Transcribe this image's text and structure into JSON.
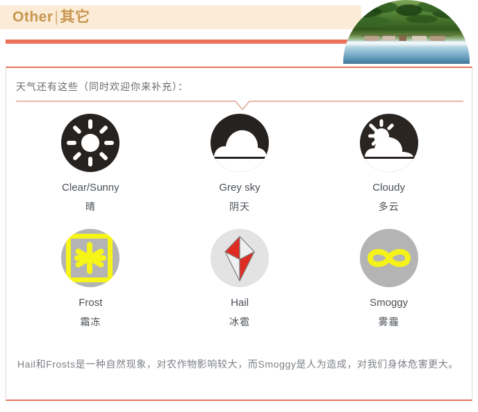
{
  "header": {
    "title_en": "Other",
    "separator": "|",
    "title_zh": "其它",
    "photo_alt": "mountain-village-river-photo"
  },
  "card": {
    "intro": "天气还有这些（同时欢迎你来补充）：",
    "note": "Hail和Frosts是一种自然现象，对农作物影响较大，而Smoggy是人为造成，对我们身体危害更大。"
  },
  "weather_items": [
    {
      "icon": "clear-sunny-icon",
      "label_en": "Clear/Sunny",
      "label_zh": "晴",
      "circle_color": "#262220",
      "glyph_color": "#ffffff"
    },
    {
      "icon": "grey-sky-icon",
      "label_en": "Grey sky",
      "label_zh": "阴天",
      "circle_color": "#262220",
      "glyph_color": "#ffffff"
    },
    {
      "icon": "cloudy-icon",
      "label_en": "Cloudy",
      "label_zh": "多云",
      "circle_color": "#2b2522",
      "glyph_color": "#ffffff"
    },
    {
      "icon": "frost-icon",
      "label_en": "Frost",
      "label_zh": "霜冻",
      "circle_color": "#b4b4b4",
      "glyph_color": "#f7f518"
    },
    {
      "icon": "hail-icon",
      "label_en": "Hail",
      "label_zh": "冰雹",
      "circle_color": "#e3e3e3",
      "glyph_color": "#e02b22"
    },
    {
      "icon": "smoggy-icon",
      "label_en": "Smoggy",
      "label_zh": "雾霾",
      "circle_color": "#b4b4b4",
      "glyph_color": "#f5f21a"
    }
  ],
  "theme": {
    "header_band": "#fbebd7",
    "header_title_color": "#c8964f",
    "accent_bar": "#ec7158",
    "card_border": "#d8d8d8",
    "card_accent": "#e2725b",
    "separator_line": "#d98b7c",
    "text_muted": "#6b6b6b",
    "label_color": "#4a4f55"
  }
}
